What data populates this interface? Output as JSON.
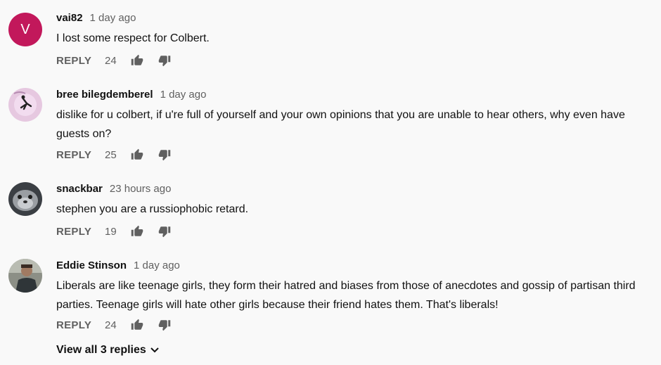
{
  "comments": [
    {
      "author": "vai82",
      "time": "1 day ago",
      "text": "I lost some respect for Colbert.",
      "reply_label": "REPLY",
      "likes": "24",
      "avatar_letter": "V",
      "avatar_color": "#c2185b"
    },
    {
      "author": "bree bilegdemberel",
      "time": "1 day ago",
      "text": "dislike for u colbert, if u're full of yourself and your own opinions that you are unable to hear others, why even have guests on?",
      "reply_label": "REPLY",
      "likes": "25"
    },
    {
      "author": "snackbar",
      "time": "23 hours ago",
      "text": "stephen you are a russiophobic retard.",
      "reply_label": "REPLY",
      "likes": "19"
    },
    {
      "author": "Eddie Stinson",
      "time": "1 day ago",
      "text": "Liberals are like teenage girls, they form their hatred and biases from those of anecdotes and gossip of partisan third parties. Teenage girls will hate other girls because their friend hates them. That's liberals!",
      "reply_label": "REPLY",
      "likes": "24"
    }
  ],
  "view_replies_label": "View all 3 replies"
}
